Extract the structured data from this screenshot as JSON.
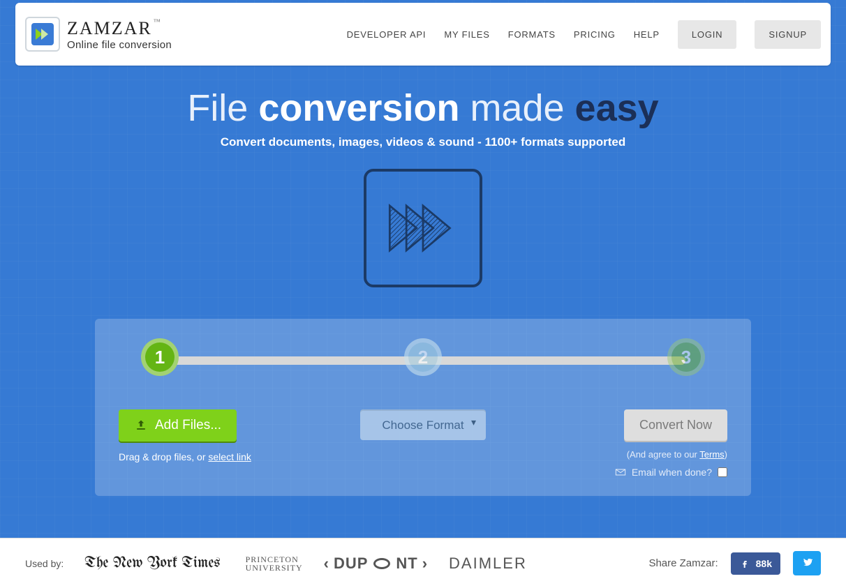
{
  "header": {
    "brand": "ZAMZAR",
    "trademark": "™",
    "tagline": "Online file conversion",
    "nav": {
      "developer_api": "DEVELOPER API",
      "my_files": "MY FILES",
      "formats": "FORMATS",
      "pricing": "PRICING",
      "help": "HELP"
    },
    "login_button": "LOGIN",
    "signup_button": "SIGNUP"
  },
  "hero": {
    "title_pre": "File ",
    "title_strong_a": "conversion",
    "title_mid": " made ",
    "title_strong_b": "easy",
    "subtitle": "Convert documents, images, videos & sound - 1100+ formats supported"
  },
  "steps": {
    "one": "1",
    "two": "2",
    "three": "3"
  },
  "converter": {
    "add_files_label": "Add Files...",
    "drag_prefix": "Drag & drop files, or ",
    "drag_link": "select link",
    "choose_format_label": "Choose Format",
    "convert_now_label": "Convert Now",
    "agree_prefix": "(And agree to our ",
    "agree_link": "Terms",
    "agree_suffix": ")",
    "email_label": "Email when done?"
  },
  "footer": {
    "used_by_label": "Used by:",
    "logos": {
      "nyt": "The New York Times",
      "princeton_top": "PRINCETON",
      "princeton_bottom": "UNIVERSITY",
      "dupont_left": "DUP",
      "dupont_right": "NT",
      "daimler": "DAIMLER"
    },
    "share_label": "Share Zamzar:",
    "facebook_count": "88k"
  }
}
